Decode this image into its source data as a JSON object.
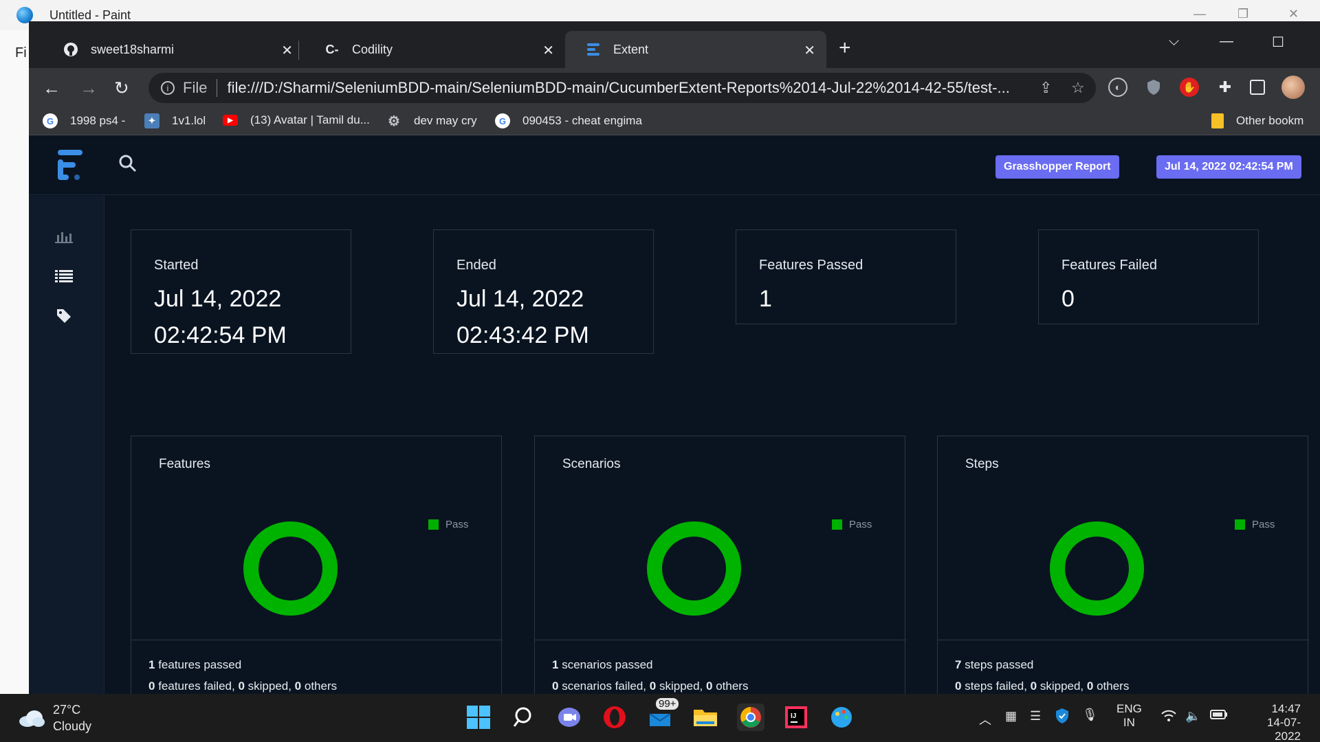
{
  "paint": {
    "title": "Untitled - Paint",
    "menu_fragment": "Fi"
  },
  "browser": {
    "tabs": [
      {
        "label": "sweet18sharmi",
        "icon": "github-icon"
      },
      {
        "label": "Codility",
        "icon": "codility-icon"
      },
      {
        "label": "Extent",
        "icon": "extent-icon"
      }
    ],
    "address": {
      "scheme_label": "File",
      "url": "file:///D:/Sharmi/SeleniumBDD-main/SeleniumBDD-main/CucumberExtent-Reports%2014-Jul-22%2014-42-55/test-..."
    },
    "bookmarks": [
      {
        "label": "1998 ps4 -",
        "icon": "google-icon"
      },
      {
        "label": "1v1.lol",
        "icon": "game-icon"
      },
      {
        "label": "(13) Avatar | Tamil du...",
        "icon": "youtube-icon"
      },
      {
        "label": "dev may cry",
        "icon": "gear-icon"
      },
      {
        "label": "090453 - cheat engima",
        "icon": "google-icon"
      },
      {
        "label": "Other bookm",
        "icon": "folder-icon"
      }
    ]
  },
  "report": {
    "badges": {
      "report_name": "Grasshopper Report",
      "timestamp": "Jul 14, 2022 02:42:54 PM"
    },
    "stats": [
      {
        "title": "Started",
        "line1": "Jul 14, 2022",
        "line2": "02:42:54 PM"
      },
      {
        "title": "Ended",
        "line1": "Jul 14, 2022",
        "line2": "02:43:42 PM"
      },
      {
        "title": "Features Passed",
        "line1": "1",
        "line2": ""
      },
      {
        "title": "Features Failed",
        "line1": "0",
        "line2": ""
      }
    ],
    "panels": [
      {
        "title": "Features",
        "legend": "Pass",
        "passed_count": "1",
        "passed_label": " features passed",
        "failed_count": "0",
        "failed_label": " features failed, ",
        "skipped_count": "0",
        "skipped_label": " skipped, ",
        "others_count": "0",
        "others_label": " others"
      },
      {
        "title": "Scenarios",
        "legend": "Pass",
        "passed_count": "1",
        "passed_label": " scenarios passed",
        "failed_count": "0",
        "failed_label": " scenarios failed, ",
        "skipped_count": "0",
        "skipped_label": " skipped, ",
        "others_count": "0",
        "others_label": " others"
      },
      {
        "title": "Steps",
        "legend": "Pass",
        "passed_count": "7",
        "passed_label": " steps passed",
        "failed_count": "0",
        "failed_label": " steps failed, ",
        "skipped_count": "0",
        "skipped_label": " skipped, ",
        "others_count": "0",
        "others_label": " others"
      }
    ],
    "colors": {
      "pass": "#00b300",
      "badge": "#6a6cf1",
      "background": "#0a1421"
    }
  },
  "taskbar": {
    "weather": {
      "temp": "27°C",
      "condition": "Cloudy"
    },
    "mail_badge": "99+",
    "lang": {
      "line1": "ENG",
      "line2": "IN"
    },
    "clock": {
      "time": "14:47",
      "date": "14-07-2022"
    }
  }
}
